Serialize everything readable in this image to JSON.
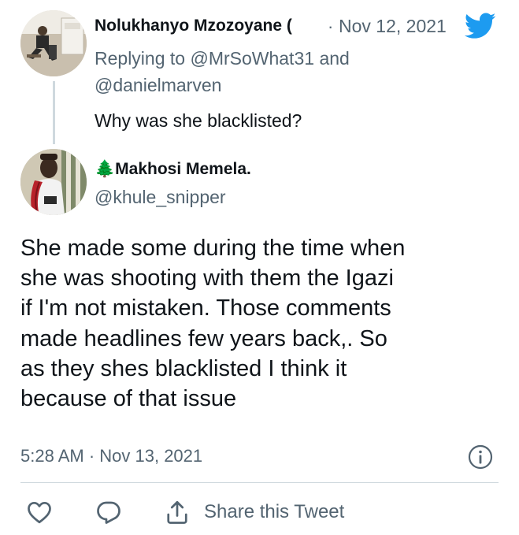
{
  "parent_tweet": {
    "author_name": "Nolukhanyo Mzozoyane (",
    "separator": "·",
    "date": "Nov 12, 2021",
    "replying_to_label": "Replying to",
    "replying_to_1": "@MrSoWhat31",
    "and_label": "and",
    "replying_to_2": "@danielmarven",
    "text": "Why was she blacklisted?"
  },
  "reply_tweet": {
    "author_emoji": "🌲",
    "author_name": "Makhosi Memela.",
    "handle": "@khule_snipper",
    "text_lines": [
      "She made some during the time when",
      "she was shooting with them the Igazi",
      "if I'm not mistaken. Those comments",
      "made headlines few years back,. So",
      "as they shes blacklisted I think it",
      "because of that issue"
    ],
    "timestamp": "5:28 AM · Nov 13, 2021"
  },
  "actions": {
    "share_label": "Share this Tweet"
  },
  "colors": {
    "brand": "#1d9bf0",
    "secondary_text": "#536471",
    "divider": "#cfd9de"
  },
  "icons": [
    "twitter-bird-icon",
    "info-icon",
    "heart-icon",
    "reply-icon",
    "share-icon",
    "tree-emoji"
  ]
}
